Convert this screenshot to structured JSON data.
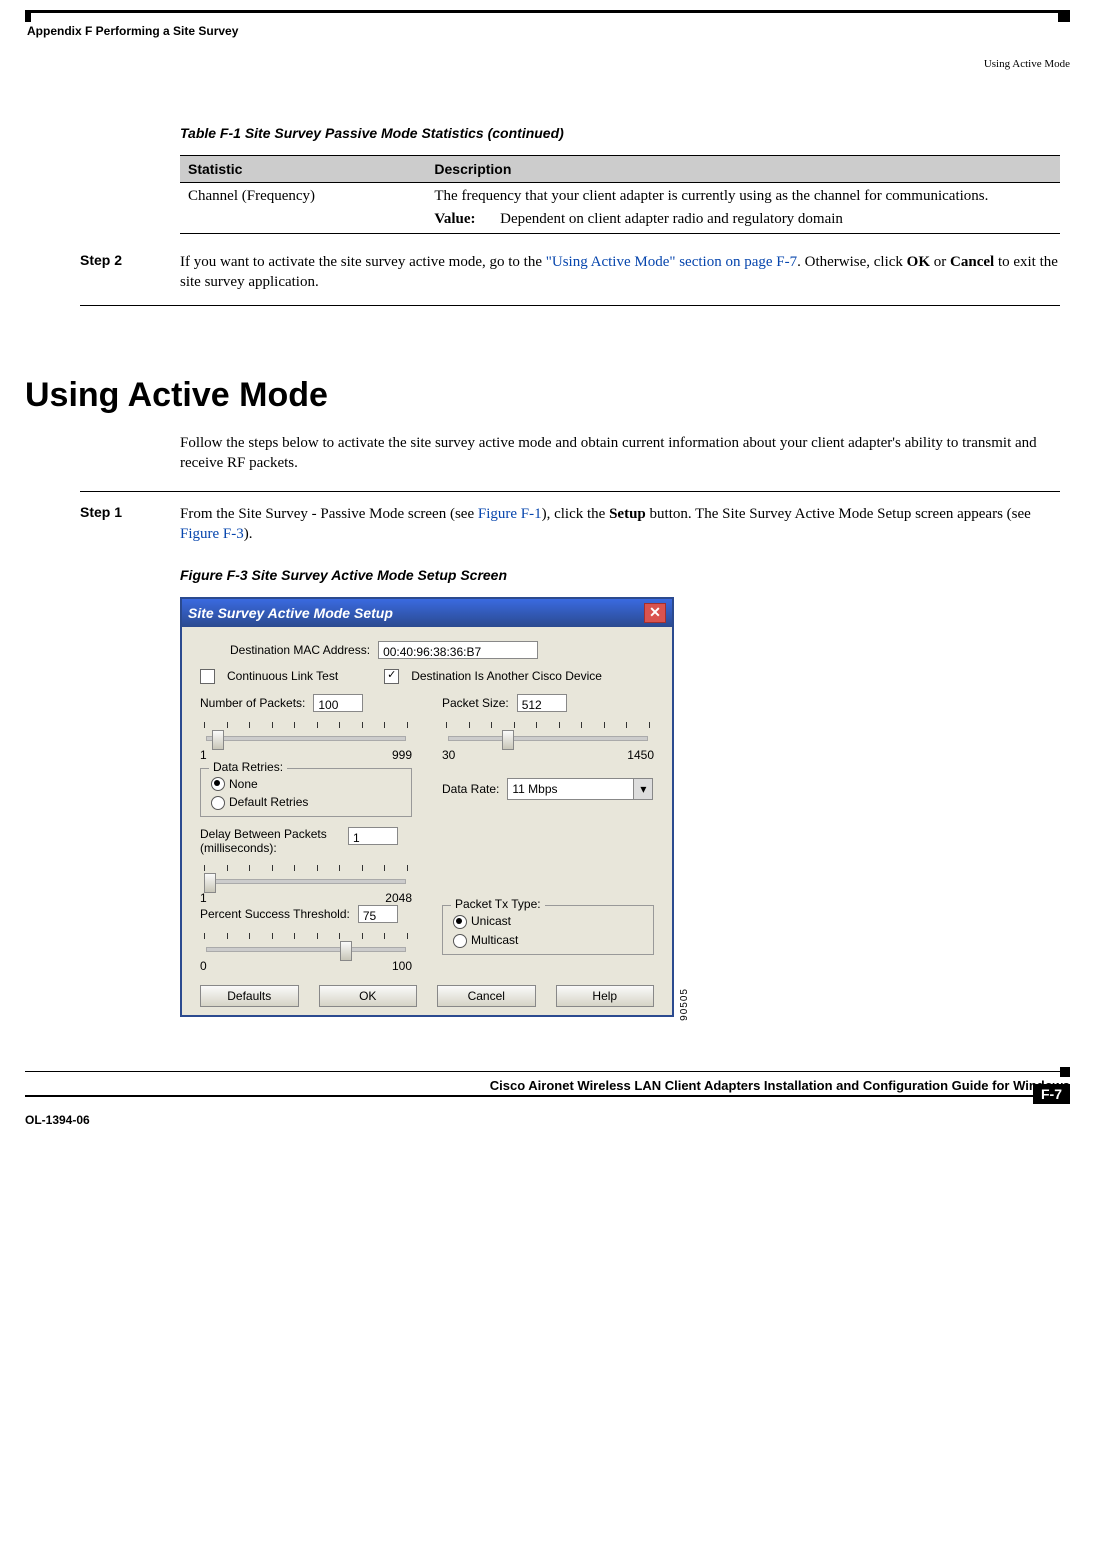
{
  "header": {
    "left": "Appendix F      Performing a Site Survey",
    "right": "Using Active Mode"
  },
  "table": {
    "caption": "Table F-1 Site Survey Passive Mode Statistics (continued)",
    "col1": "Statistic",
    "col2": "Description",
    "row": {
      "stat": "Channel (Frequency)",
      "desc": "The frequency that your client adapter is currently using as the channel for communications.",
      "value_label": "Value:",
      "value_text": "Dependent on client adapter radio and regulatory domain"
    }
  },
  "step2": {
    "label": "Step 2",
    "pre": "If you want to activate the site survey active mode, go to the ",
    "link": "\"Using Active Mode\" section on page F-7",
    "post1": ". Otherwise, click ",
    "ok": "OK",
    "mid": " or ",
    "cancel": "Cancel",
    "post2": " to exit the site survey application."
  },
  "section_title": "Using Active Mode",
  "intro": "Follow the steps below to activate the site survey active mode and obtain current information about your client adapter's ability to transmit and receive RF packets.",
  "step1": {
    "label": "Step 1",
    "pre": "From the Site Survey - Passive Mode screen (see ",
    "link1": "Figure F-1",
    "mid1": "), click the ",
    "setup": "Setup",
    "mid2": " button. The Site Survey Active Mode Setup screen appears (see ",
    "link2": "Figure F-3",
    "post": ")."
  },
  "figure_caption": "Figure F-3 Site Survey Active Mode Setup Screen",
  "dialog": {
    "title": "Site Survey Active Mode Setup",
    "dest_mac_label": "Destination MAC Address:",
    "dest_mac_value": "00:40:96:38:36:B7",
    "cont_link": "Continuous Link Test",
    "dest_cisco": "Destination Is Another Cisco Device",
    "num_packets_label": "Number of Packets:",
    "num_packets_value": "100",
    "num_packets_min": "1",
    "num_packets_max": "999",
    "packet_size_label": "Packet Size:",
    "packet_size_value": "512",
    "packet_size_min": "30",
    "packet_size_max": "1450",
    "data_retries_legend": "Data Retries:",
    "retries_none": "None",
    "retries_default": "Default Retries",
    "data_rate_label": "Data Rate:",
    "data_rate_value": "11 Mbps",
    "delay_label": "Delay Between Packets (milliseconds):",
    "delay_value": "1",
    "delay_min": "1",
    "delay_max": "2048",
    "tx_type_legend": "Packet Tx Type:",
    "tx_unicast": "Unicast",
    "tx_multicast": "Multicast",
    "pct_label": "Percent Success Threshold:",
    "pct_value": "75",
    "pct_min": "0",
    "pct_max": "100",
    "btn_defaults": "Defaults",
    "btn_ok": "OK",
    "btn_cancel": "Cancel",
    "btn_help": "Help",
    "img_num": "90505"
  },
  "footer": {
    "title": "Cisco Aironet Wireless LAN Client Adapters Installation and Configuration Guide for Windows",
    "doc": "OL-1394-06",
    "page": "F-7"
  }
}
